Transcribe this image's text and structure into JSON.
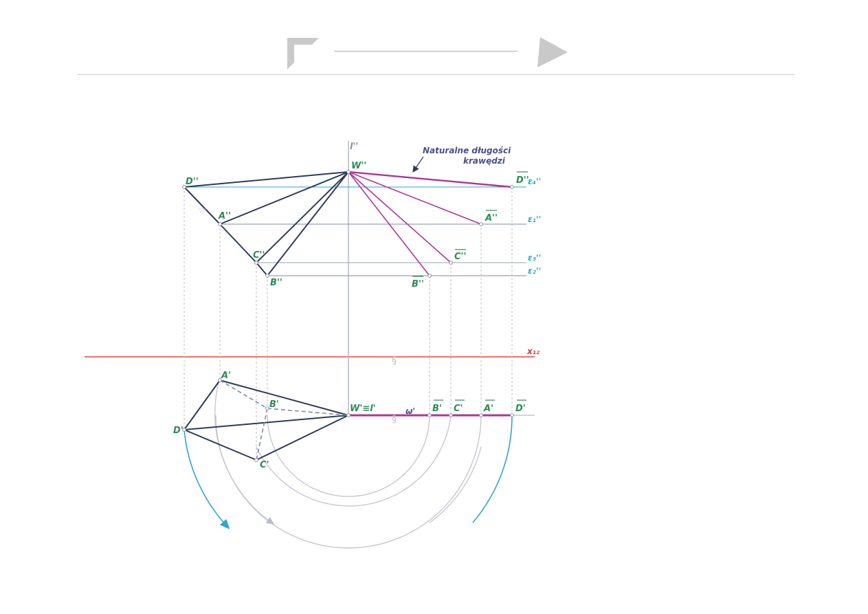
{
  "header": {
    "nav_prev_icon": "corner-arrow-icon",
    "nav_next_icon": "triangle-play-icon"
  },
  "diagram": {
    "annotation_line1": "Naturalne długości",
    "annotation_line2": "krawędzi",
    "labels": {
      "l2": "l''",
      "W2": "W''",
      "D2": "D''",
      "A2": "A''",
      "C2": "C''",
      "B2": "B''",
      "D2bar": "D''",
      "A2bar": "A''",
      "C2bar": "C''",
      "B2bar": "B''",
      "eps_d": "ε₄''",
      "eps_a": "ε₁''",
      "eps_c": "ε₃''",
      "eps_b": "ε₂''",
      "x12": "x₁₂",
      "A1": "A'",
      "B1": "B'",
      "C1": "C'",
      "D1": "D'",
      "W1": "W'≡l'",
      "omega": "ω'",
      "B1bar": "B'",
      "C1bar": "C'",
      "A1bar": "A'",
      "D1bar": "D'"
    },
    "colors": {
      "pyramid_edges": "#2c3a5c",
      "true_lengths": "#b0349a",
      "level_lines": "#2aa6d6",
      "axis_x12": "#e6453f",
      "construction": "#b8bcc8",
      "rotation_arrows": "#2aa6d6"
    }
  }
}
